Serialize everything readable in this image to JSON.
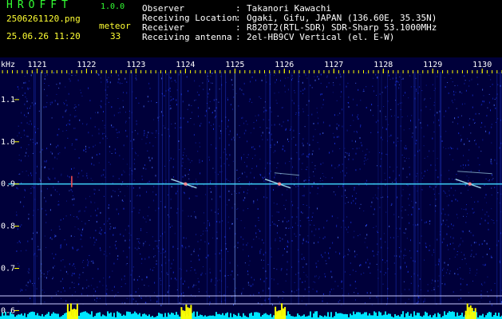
{
  "header": {
    "title": "HROFFT",
    "version": "1.0.0",
    "filename": "2506261120.png",
    "datetime": "25.06.26 11:20",
    "meteor_label": "meteor",
    "meteor_count": "33",
    "info": [
      {
        "label": "Observer",
        "value": "Takanori Kawachi"
      },
      {
        "label": "Receiving Location",
        "value": "Ogaki, Gifu, JAPAN (136.60E, 35.35N)"
      },
      {
        "label": "Receiver",
        "value": "R820T2(RTL-SDR) SDR-Sharp 53.1000MHz"
      },
      {
        "label": "Receiving antenna",
        "value": "2el-HB9CV Vertical (el. E-W)"
      }
    ]
  },
  "chart_data": {
    "type": "heatmap",
    "ylabel": "kHz",
    "x_ticks": [
      "1121",
      "1122",
      "1123",
      "1124",
      "1125",
      "1126",
      "1127",
      "1128",
      "1129",
      "1130"
    ],
    "y_ticks": [
      "1.1",
      "1.0",
      "0.9",
      "0.8",
      "0.7",
      "0.6"
    ],
    "y_tick_values": [
      1.1,
      1.0,
      0.9,
      0.8,
      0.7,
      0.6
    ],
    "ylim": [
      0.58,
      1.2
    ],
    "xlim": [
      1120.25,
      1130.4
    ],
    "carrier_khz": 0.9,
    "carrier_x_start": 1120.42,
    "echoes": [
      1124.0,
      1125.9,
      1129.75
    ],
    "colors": {
      "background": "#00003a",
      "noise": "#1e3cff",
      "carrier": "#40d8ff",
      "tick": "#ffff00",
      "level": "#00e5ff",
      "level_peak": "#ffff00"
    }
  }
}
